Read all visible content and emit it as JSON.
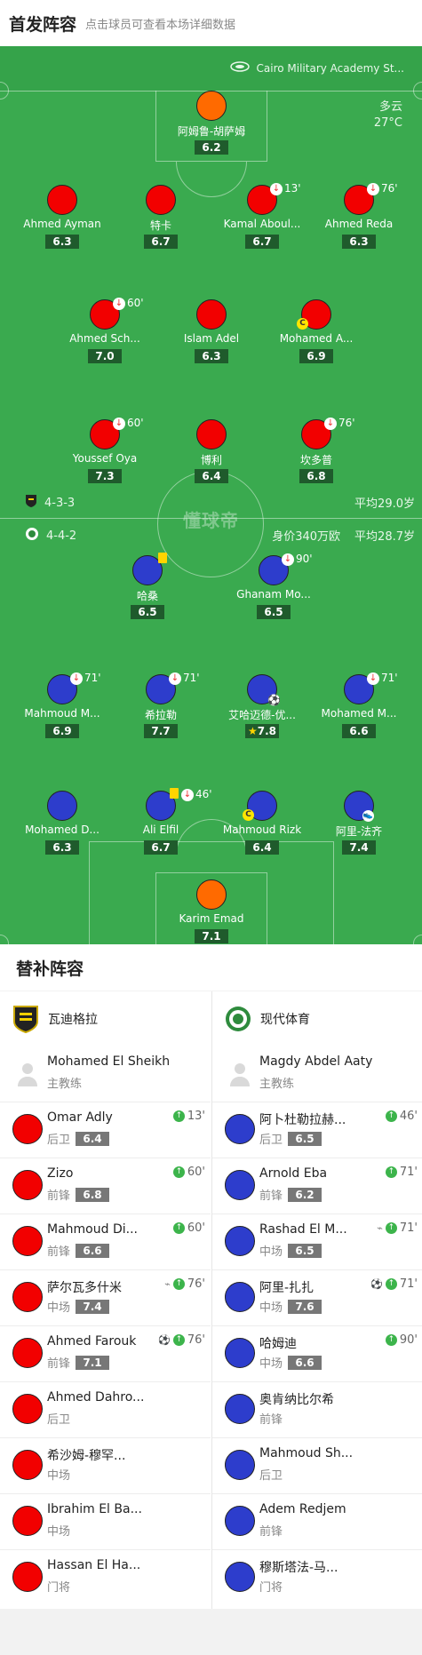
{
  "header": {
    "title": "首发阵容",
    "hint": "点击球员可查看本场详细数据"
  },
  "pitch": {
    "venue": "Cairo Military Academy St...",
    "weather": {
      "condition": "多云",
      "temp": "27°C"
    },
    "watermark": "懂球帝",
    "home": {
      "formation": "4-3-3",
      "avg_age": "平均29.0岁"
    },
    "away": {
      "formation": "4-4-2",
      "value": "身价340万欧",
      "avg_age": "平均28.7岁"
    }
  },
  "home_players": [
    {
      "name": "阿姆鲁-胡萨姆",
      "rating": "6.2",
      "color": "orange"
    },
    {
      "name": "Ahmed Ayman",
      "rating": "6.3",
      "color": "red"
    },
    {
      "name": "特卡",
      "rating": "6.7",
      "color": "red"
    },
    {
      "name": "Kamal Aboul...",
      "rating": "6.7",
      "color": "red",
      "sub": "13'"
    },
    {
      "name": "Ahmed Reda",
      "rating": "6.3",
      "color": "red",
      "sub": "76'"
    },
    {
      "name": "Ahmed Sch...",
      "rating": "7.0",
      "color": "red",
      "sub": "60'"
    },
    {
      "name": "Islam Adel",
      "rating": "6.3",
      "color": "red"
    },
    {
      "name": "Mohamed A...",
      "rating": "6.9",
      "color": "red",
      "captain": "C"
    },
    {
      "name": "Youssef Oya",
      "rating": "7.3",
      "color": "red",
      "sub": "60'"
    },
    {
      "name": "博利",
      "rating": "6.4",
      "color": "red"
    },
    {
      "name": "坎多普",
      "rating": "6.8",
      "color": "red",
      "sub": "76'"
    }
  ],
  "away_players": [
    {
      "name": "哈桑",
      "rating": "6.5",
      "color": "blue",
      "yellow": true
    },
    {
      "name": "Ghanam Mo...",
      "rating": "6.5",
      "color": "blue",
      "sub": "90'"
    },
    {
      "name": "Mahmoud M...",
      "rating": "6.9",
      "color": "blue",
      "sub": "71'"
    },
    {
      "name": "希拉勒",
      "rating": "7.7",
      "color": "blue",
      "sub": "71'"
    },
    {
      "name": "艾哈迈德-优...",
      "rating": "7.8",
      "color": "blue",
      "star": true,
      "goal": true
    },
    {
      "name": "Mohamed M...",
      "rating": "6.6",
      "color": "blue",
      "sub": "71'"
    },
    {
      "name": "Mohamed D...",
      "rating": "6.3",
      "color": "blue"
    },
    {
      "name": "Ali Elfil",
      "rating": "6.7",
      "color": "blue",
      "yellow": true,
      "sub": "46'"
    },
    {
      "name": "Mahmoud Rizk",
      "rating": "6.4",
      "color": "blue",
      "captain": "C"
    },
    {
      "name": "阿里-法齐",
      "rating": "7.4",
      "color": "blue",
      "assist": true
    },
    {
      "name": "Karim Emad",
      "rating": "7.1",
      "color": "orange"
    }
  ],
  "subs": {
    "title": "替补阵容",
    "home": {
      "team": "瓦迪格拉",
      "coach": {
        "name": "Mohamed El Sheikh",
        "role": "主教练"
      },
      "players": [
        {
          "name": "Omar Adly",
          "pos": "后卫",
          "rating": "6.4",
          "min": "13'"
        },
        {
          "name": "Zizo",
          "pos": "前锋",
          "rating": "6.8",
          "min": "60'"
        },
        {
          "name": "Mahmoud Di...",
          "pos": "前锋",
          "rating": "6.6",
          "min": "60'"
        },
        {
          "name": "萨尔瓦多什米",
          "pos": "中场",
          "rating": "7.4",
          "min": "76'",
          "assist": true
        },
        {
          "name": "Ahmed Farouk",
          "pos": "前锋",
          "rating": "7.1",
          "min": "76'",
          "goal": true
        },
        {
          "name": "Ahmed Dahro...",
          "pos": "后卫"
        },
        {
          "name": "希沙姆-穆罕...",
          "pos": "中场"
        },
        {
          "name": "Ibrahim El Ba...",
          "pos": "中场"
        },
        {
          "name": "Hassan El Ha...",
          "pos": "门将"
        }
      ]
    },
    "away": {
      "team": "现代体育",
      "coach": {
        "name": "Magdy Abdel Aaty",
        "role": "主教练"
      },
      "players": [
        {
          "name": "阿卜杜勒拉赫...",
          "pos": "后卫",
          "rating": "6.5",
          "min": "46'"
        },
        {
          "name": "Arnold Eba",
          "pos": "前锋",
          "rating": "6.2",
          "min": "71'"
        },
        {
          "name": "Rashad El M...",
          "pos": "中场",
          "rating": "6.5",
          "min": "71'",
          "assist": true
        },
        {
          "name": "阿里-扎扎",
          "pos": "中场",
          "rating": "7.6",
          "min": "71'",
          "goal": true
        },
        {
          "name": "哈姆迪",
          "pos": "中场",
          "rating": "6.6",
          "min": "90'"
        },
        {
          "name": "奥肯纳比尔希",
          "pos": "前锋"
        },
        {
          "name": "Mahmoud Sh...",
          "pos": "后卫"
        },
        {
          "name": "Adem Redjem",
          "pos": "前锋"
        },
        {
          "name": "穆斯塔法-马...",
          "pos": "门将"
        }
      ]
    }
  },
  "colors": {
    "pitch": "#3aaa4f",
    "home": "#f20000",
    "away": "#2d3dcc",
    "gk": "#ff6a00"
  }
}
